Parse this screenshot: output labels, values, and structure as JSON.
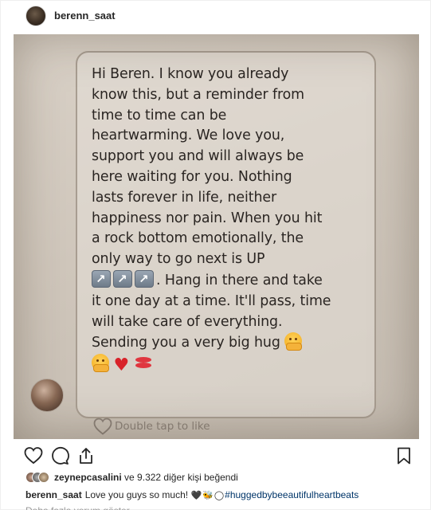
{
  "header": {
    "username": "berenn_saat"
  },
  "post_image": {
    "message_lines": [
      "Hi Beren. I know you already",
      "know this, but a reminder from",
      "time to time can be",
      "heartwarming. We love you,",
      "support you and will always be",
      "here waiting for you. Nothing",
      "lasts forever in life, neither",
      "happiness nor pain. When you hit",
      "a rock bottom emotionally, the",
      "only way to go next is UP"
    ],
    "arrow_line_text": ". Hang in there and take",
    "message_lines_after": [
      "it one day at a time. It'll pass, time",
      "will take care of everything."
    ],
    "hug_line": "Sending you a very big hug",
    "double_tap_label": "Double tap to like",
    "icons": {
      "arrows": [
        "up-right-arrow-icon",
        "up-right-arrow-icon",
        "up-right-arrow-icon"
      ],
      "emojis": [
        "hug-emoji-icon",
        "hug-emoji-icon",
        "red-heart-icon",
        "kiss-lips-icon"
      ]
    }
  },
  "actions": {
    "icons": [
      "heart-outline-icon",
      "comment-icon",
      "share-icon",
      "bookmark-icon"
    ]
  },
  "likes": {
    "liker_username": "zeynepcasalini",
    "rest": " ve 9.322 diğer kişi beğendi"
  },
  "caption": {
    "username": "berenn_saat",
    "text": "Love you guys so much!",
    "emojis": "🖤🐝◯",
    "hashtag": "#huggedbybeeautifulheartbeats"
  },
  "comments_preview": {
    "text": "Daha fazla yorum göster"
  },
  "colors": {
    "image_bg": "#cfc6bb",
    "bubble_border": "#a89d91",
    "hashtag": "#003569",
    "heart_red": "#d8232a"
  }
}
